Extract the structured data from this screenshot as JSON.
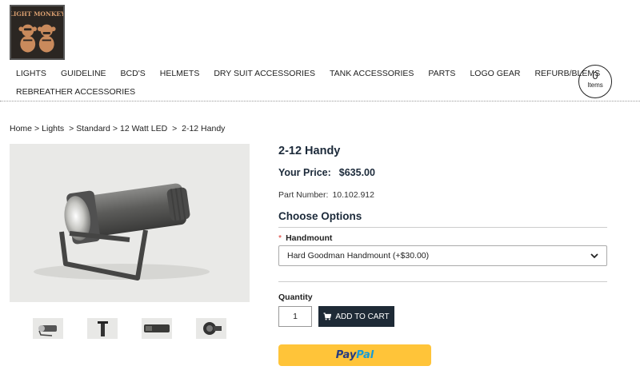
{
  "logo": {
    "text": "LIGHT MONKEY",
    "icon": "three-monkeys-logo"
  },
  "nav": {
    "row1": [
      "LIGHTS",
      "GUIDELINE",
      "BCD'S",
      "HELMETS",
      "DRY SUIT ACCESSORIES",
      "TANK ACCESSORIES",
      "PARTS",
      "LOGO GEAR",
      "REFURB/BLEMS"
    ],
    "row2": [
      "REBREATHER ACCESSORIES"
    ]
  },
  "cart": {
    "count": "0",
    "label": "Items"
  },
  "breadcrumb": [
    "Home",
    "Lights",
    "Standard",
    "12 Watt LED",
    "2-12 Handy"
  ],
  "product": {
    "title": "2-12 Handy",
    "price_label": "Your Price:",
    "price": "$635.00",
    "part_label": "Part Number:",
    "part_number": "10.102.912"
  },
  "options": {
    "heading": "Choose Options",
    "required_mark": "*",
    "field_label": "Handmount",
    "selected": "Hard Goodman Handmount (+$30.00)"
  },
  "quantity": {
    "label": "Quantity",
    "value": "1"
  },
  "buttons": {
    "add_to_cart": "ADD TO CART",
    "paypal_part1": "Pay",
    "paypal_part2": "Pal"
  },
  "colors": {
    "button_dark": "#1e2a36",
    "paypal_yellow": "#ffc439",
    "title_navy": "#1c2a3a",
    "required_red": "#d9342b"
  }
}
